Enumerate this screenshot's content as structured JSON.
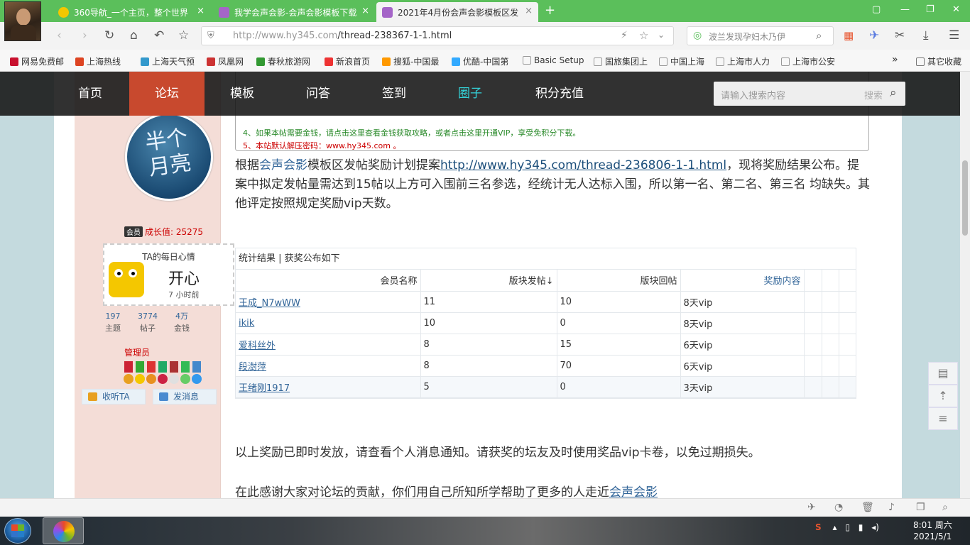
{
  "browser": {
    "tabs": [
      {
        "label": "360导航_一个主页，整个世界",
        "icon_color": "#f4c700"
      },
      {
        "label": "我学会声会影-会声会影模板下载",
        "icon_color": "#a565c8"
      },
      {
        "label": "2021年4月份会声会影模板区发",
        "icon_color": "#a565c8"
      }
    ],
    "close_glyph": "×",
    "new_tab_glyph": "+",
    "url_host": "http://www.hy345.com",
    "url_path": "/thread-238367-1-1.html",
    "search_placeholder": "波兰发现孕妇木乃伊",
    "bookmarks": [
      {
        "label": "网易免费邮",
        "color": "#c8102e"
      },
      {
        "label": "上海热线",
        "color": "#d42"
      },
      {
        "label": "上海天气预",
        "color": "#39c"
      },
      {
        "label": "凤凰网",
        "color": "#c33"
      },
      {
        "label": "春秋旅游网",
        "color": "#393"
      },
      {
        "label": "新浪首页",
        "color": "#e33"
      },
      {
        "label": "搜狐-中国最",
        "color": "#f90"
      },
      {
        "label": "优酷-中国第",
        "color": "#3af"
      },
      {
        "label": "Basic Setup",
        "color": "#bbb"
      },
      {
        "label": "国旅集团上",
        "color": "#bbb"
      },
      {
        "label": "中国上海",
        "color": "#bbb"
      },
      {
        "label": "上海市人力",
        "color": "#bbb"
      },
      {
        "label": "上海市公安",
        "color": "#bbb"
      }
    ],
    "bookmarks_more": "»",
    "other_bookmarks": "其它收藏"
  },
  "site": {
    "nav": [
      "首页",
      "论坛",
      "模板",
      "问答",
      "签到",
      "圈子",
      "积分充值"
    ],
    "search_placeholder": "请输入搜索内容",
    "search_button": "搜索"
  },
  "notice": {
    "hidden_title": "半个月亮",
    "lines": [
      {
        "text": "4、如果本帖需要金钱，请点击这里查看金钱获取攻略，或者点击这里开通VIP，享受免积分下载。",
        "color": "#2a8a2a"
      },
      {
        "text": "5、本站默认解压密码：www.hy345.com 。",
        "color": "#c00"
      }
    ]
  },
  "profile": {
    "avatar_text": "半个月亮",
    "vip_badge": "会员",
    "growth": "成长值: 25275",
    "mood_title": "TA的每日心情",
    "mood": "开心",
    "mood_time": "7 小时前",
    "stats": [
      {
        "value": "197",
        "label": "主题"
      },
      {
        "value": "3774",
        "label": "帖子"
      },
      {
        "value": "4万",
        "label": "金钱"
      }
    ],
    "role": "管理员",
    "follow_button": "收听TA",
    "message_button": "发消息"
  },
  "post": {
    "p1_before": "根据",
    "p1_link": "会声会影",
    "p1_mid": "模板区发帖奖励计划提案",
    "p1_url": "http://www.hy345.com/thread-236806-1-1.html",
    "p1_after": "，现将奖励结果公布。提案中拟定发帖量需达到15帖以上方可入围前三名参选，经统计无人达标入围，所以第一名、第二名、第三名 均缺失。其他评定按照规定奖励vip天数。",
    "table_caption": "统计结果 | 获奖公布如下",
    "table_headers": [
      "会员名称",
      "版块发帖↓",
      "版块回帖",
      "奖励内容"
    ],
    "table_rows": [
      {
        "name": "王成_N7wWW",
        "posts": "11",
        "replies": "10",
        "reward": "8天vip"
      },
      {
        "name": "ikik",
        "posts": "10",
        "replies": "0",
        "reward": "8天vip"
      },
      {
        "name": "爱科丝外",
        "posts": "8",
        "replies": "15",
        "reward": "6天vip"
      },
      {
        "name": "段澍萍",
        "posts": "8",
        "replies": "70",
        "reward": "6天vip"
      },
      {
        "name": "王绪刚1917",
        "posts": "5",
        "replies": "0",
        "reward": "3天vip"
      }
    ],
    "p2": "以上奖励已即时发放，请查看个人消息通知。请获奖的坛友及时使用奖品vip卡卷，以免过期损失。",
    "p3_before": "在此感谢大家对论坛的贡献，你们用自己所知所学帮助了更多的人走近",
    "p3_link": "会声会影"
  },
  "taskbar": {
    "time": "8:01 周六",
    "date": "2021/5/1"
  }
}
